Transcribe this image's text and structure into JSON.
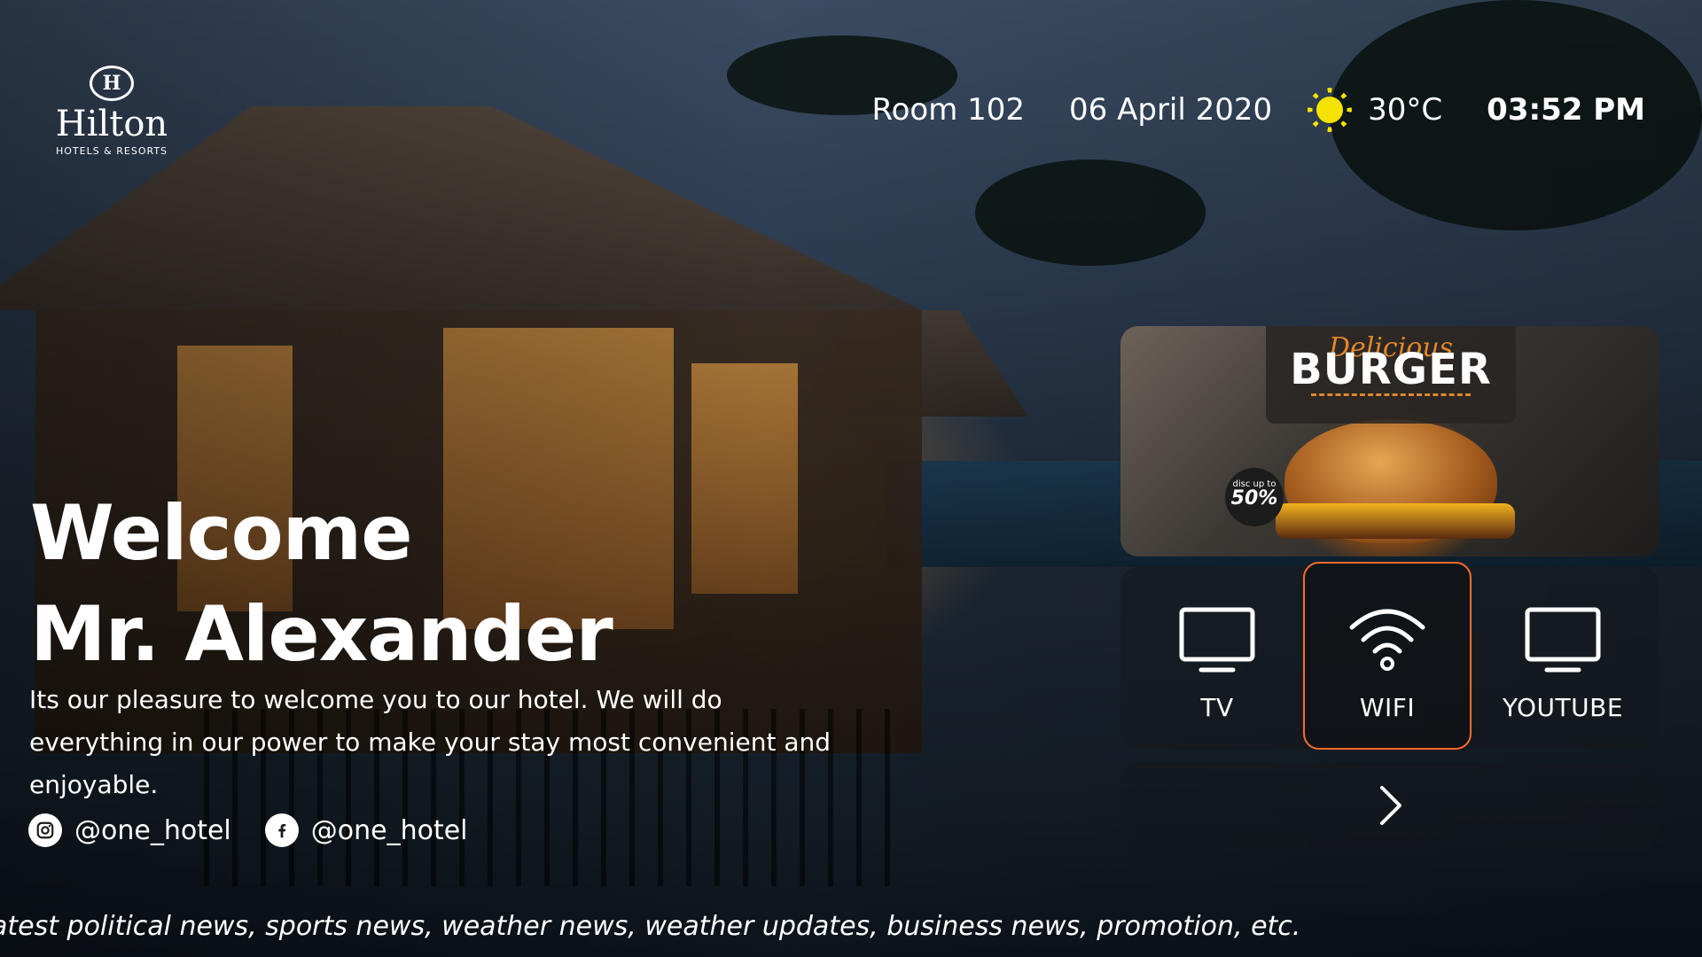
{
  "brand": {
    "name": "Hilton",
    "tagline": "HOTELS & RESORTS",
    "mark": "H"
  },
  "header": {
    "room": "Room 102",
    "date": "06 April 2020",
    "temperature": "30°C",
    "time": "03:52 PM",
    "weather_icon": "sun-icon"
  },
  "welcome": {
    "line1": "Welcome",
    "line2": "Mr. Alexander",
    "message": "Its our pleasure to welcome you to our hotel. We will do everything in our power to make your stay most convenient and enjoyable."
  },
  "social": [
    {
      "icon": "instagram-icon",
      "handle": "@one_hotel"
    },
    {
      "icon": "facebook-icon",
      "handle": "@one_hotel"
    }
  ],
  "promo": {
    "script": "Delicious",
    "title": "BURGER",
    "discount_small": "disc up to",
    "discount_big": "50%"
  },
  "apps": [
    {
      "icon": "tv-icon",
      "label": "TV",
      "selected": false
    },
    {
      "icon": "wifi-icon",
      "label": "WIFI",
      "selected": true
    },
    {
      "icon": "monitor-icon",
      "label": "YOUTUBE",
      "selected": false
    }
  ],
  "navigation": {
    "next_icon": "chevron-right-icon"
  },
  "ticker": "atest political news, sports news, weather news, weather updates, business news, promotion, etc.",
  "colors": {
    "accent": "#ff6a2a",
    "sun": "#f5e200",
    "promo_script": "#e2862a"
  }
}
